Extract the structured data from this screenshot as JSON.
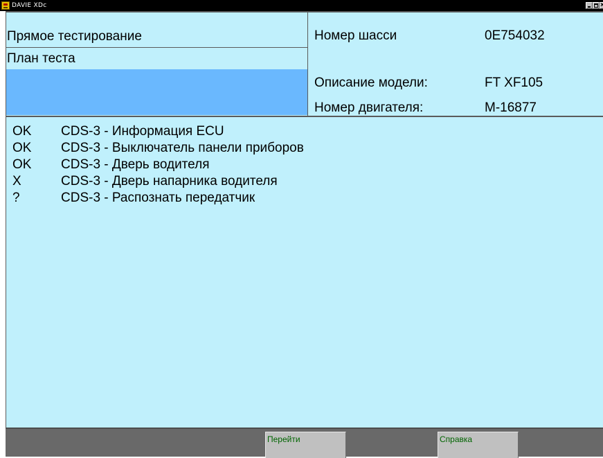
{
  "window": {
    "title": "DAVIE XDc"
  },
  "header": {
    "left": {
      "mode": "Прямое тестирование",
      "subtitle": "План теста"
    },
    "right": [
      {
        "label": "Номер шасси",
        "value": "0E754032"
      },
      {
        "label": "Описание модели:",
        "value": "FT XF105"
      },
      {
        "label": "Номер двигателя:",
        "value": "M-16877"
      }
    ]
  },
  "results": [
    {
      "status": "OK",
      "name": "CDS-3 - Информация ECU"
    },
    {
      "status": "OK",
      "name": "CDS-3 - Выключатель панели приборов"
    },
    {
      "status": "OK",
      "name": "CDS-3 - Дверь водителя"
    },
    {
      "status": "X",
      "name": "CDS-3 - Дверь напарника водителя"
    },
    {
      "status": "?",
      "name": "CDS-3 - Распознать передатчик"
    }
  ],
  "softkeys": {
    "goto": "Перейти",
    "help": "Справка"
  },
  "colors": {
    "panel": "#c0f0fc",
    "selection": "#6ab8fe",
    "softkey_text": "#006400",
    "bar": "#696969"
  }
}
